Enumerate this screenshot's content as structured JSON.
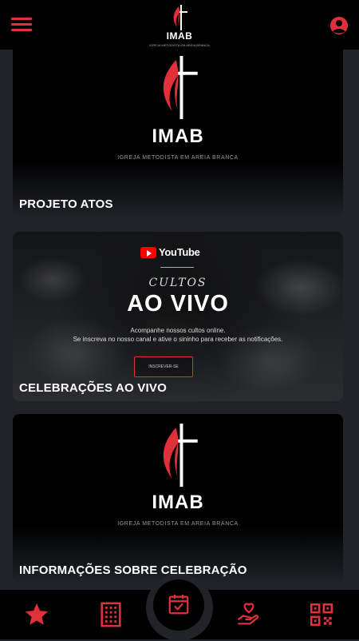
{
  "header": {
    "logo_text": "IMAB",
    "logo_subtitle": "IGREJA METODISTA EM AREIA BRANCA",
    "menu_icon": "hamburger-menu-icon",
    "profile_icon": "user-circle-icon"
  },
  "cards": [
    {
      "title": "PROJETO ATOS",
      "logo_text": "IMAB",
      "logo_subtitle": "IGREJA METODISTA EM AREIA BRANCA"
    },
    {
      "title": "CELEBRAÇÕES AO VIVO",
      "platform": "YouTube",
      "kicker": "CULTOS",
      "headline": "AO VIVO",
      "description_line1": "Acompanhe nossos cultos online.",
      "description_line2": "Se inscreva no nosso canal e ative o sininho para receber as notificações.",
      "subscribe_label": "INSCREVER-SE"
    },
    {
      "title": "INFORMAÇÕES SOBRE CELEBRAÇÃO",
      "logo_text": "IMAB",
      "logo_subtitle": "IGREJA METODISTA EM AREIA BRANCA"
    }
  ],
  "bottom_nav": {
    "items": [
      {
        "icon": "star-icon"
      },
      {
        "icon": "building-icon"
      },
      {
        "icon": "calendar-check-icon"
      },
      {
        "icon": "heart-hand-icon"
      },
      {
        "icon": "qr-code-icon"
      }
    ]
  },
  "colors": {
    "accent": "#e0303a",
    "background": "#202328",
    "bars": "#000000"
  }
}
